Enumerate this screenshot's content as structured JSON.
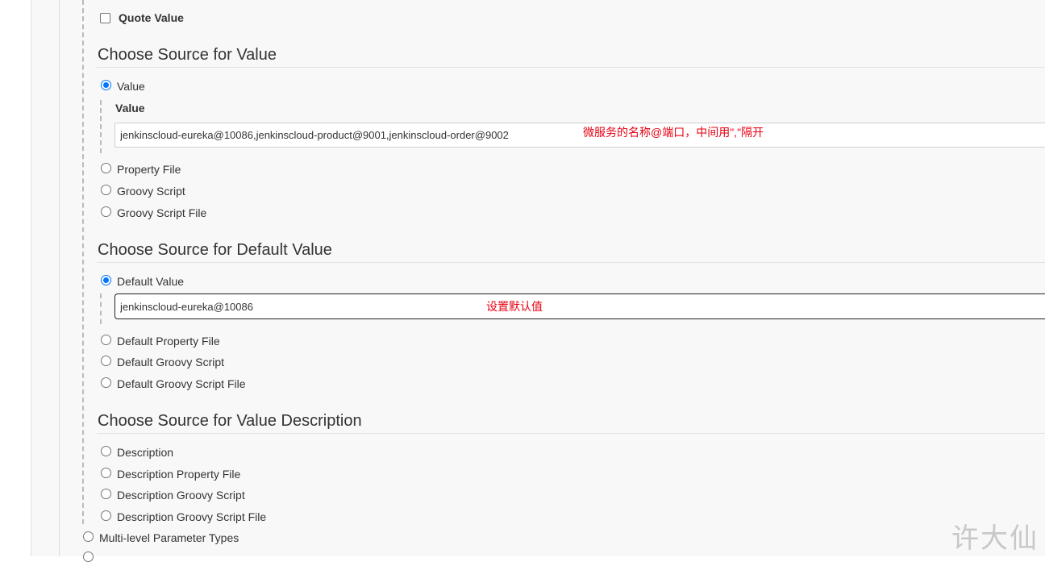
{
  "quote_value": {
    "label": "Quote Value",
    "checked": false
  },
  "sections": {
    "value": {
      "heading": "Choose Source for Value",
      "options": [
        "Value",
        "Property File",
        "Groovy Script",
        "Groovy Script File"
      ],
      "selected": "Value",
      "field_label": "Value",
      "field_value": "jenkinscloud-eureka@10086,jenkinscloud-product@9001,jenkinscloud-order@9002",
      "annotation": "微服务的名称@端口，中间用\",\"隔开"
    },
    "default_value": {
      "heading": "Choose Source for Default Value",
      "options": [
        "Default Value",
        "Default Property File",
        "Default Groovy Script",
        "Default Groovy Script File"
      ],
      "selected": "Default Value",
      "field_value": "jenkinscloud-eureka@10086",
      "annotation": "设置默认值"
    },
    "value_description": {
      "heading": "Choose Source for Value Description",
      "options": [
        "Description",
        "Description Property File",
        "Description Groovy Script",
        "Description Groovy Script File"
      ]
    }
  },
  "parameter_types": [
    "Multi-level Parameter Types"
  ],
  "watermark": "许大仙",
  "colors": {
    "annotation": "#e60012",
    "radio_checked": "#0075ff"
  }
}
